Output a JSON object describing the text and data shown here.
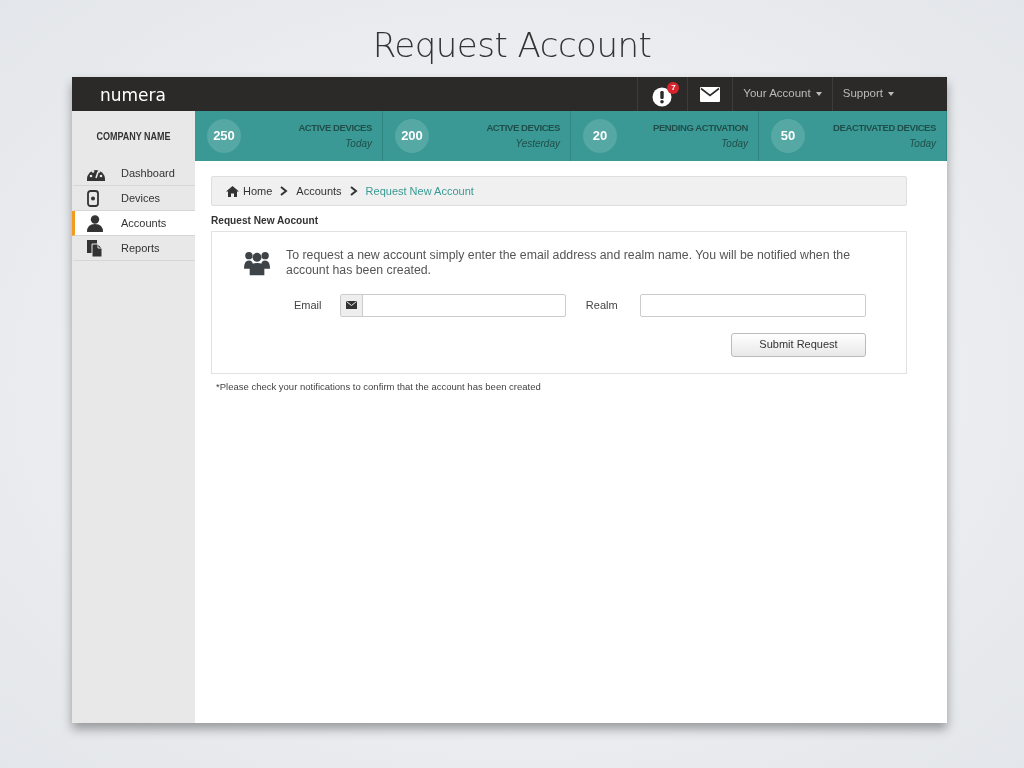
{
  "window": {
    "title": "Request Account"
  },
  "topbar": {
    "logo": "numera",
    "alerts": {
      "count": "7"
    },
    "menus": [
      {
        "label": "Your Account"
      },
      {
        "label": "Support"
      }
    ]
  },
  "sidebar": {
    "company": "COMPANY NAME",
    "items": [
      {
        "label": "Dashboard",
        "kind": "gauge",
        "selected": false
      },
      {
        "label": "Devices",
        "kind": "device",
        "selected": false
      },
      {
        "label": "Accounts",
        "kind": "person",
        "selected": true
      },
      {
        "label": "Reports",
        "kind": "report",
        "selected": false
      }
    ]
  },
  "stats": [
    {
      "value": "250",
      "label": "ACTIVE DEVICES",
      "period": "Today"
    },
    {
      "value": "200",
      "label": "ACTIVE DEVICES",
      "period": "Yesterday"
    },
    {
      "value": "20",
      "label": "PENDING ACTIVATION",
      "period": "Today"
    },
    {
      "value": "50",
      "label": "DEACTIVATED DEVICES",
      "period": "Today"
    }
  ],
  "breadcrumb": [
    {
      "label": "Home",
      "kind": "home"
    },
    {
      "label": "Accounts",
      "kind": "link"
    },
    {
      "label": "Request New Account",
      "kind": "current"
    }
  ],
  "form": {
    "heading": "Request New Aocount",
    "intro": "To request a new account simply enter the email address and realm name. You will be notified when the account has been created.",
    "fields": [
      {
        "label": "Email",
        "kind": "email"
      },
      {
        "label": "Realm",
        "kind": "text"
      }
    ],
    "submit": "Submit Request"
  },
  "footnote": "*Please check your notifications to confirm that the account has been created"
}
